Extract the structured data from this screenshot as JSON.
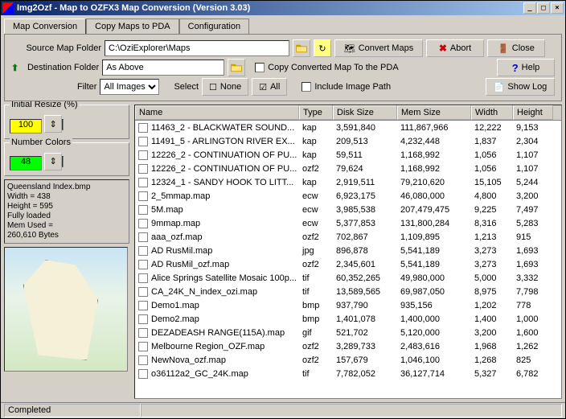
{
  "window": {
    "title": "Img2Ozf - Map to OZFX3 Map Conversion (Version 3.03)"
  },
  "tabs": {
    "map_conversion": "Map Conversion",
    "copy_maps": "Copy Maps to PDA",
    "configuration": "Configuration"
  },
  "toolbar": {
    "source_label": "Source Map Folder",
    "source_value": "C:\\OziExplorer\\Maps",
    "dest_label": "Destination Folder",
    "dest_value": "As Above",
    "filter_label": "Filter",
    "filter_value": "All Images",
    "select_label": "Select",
    "none_btn": "None",
    "all_btn": "All",
    "convert_btn": "Convert Maps",
    "abort_btn": "Abort",
    "close_btn": "Close",
    "copy_pda_checkbox": "Copy Converted Map To the PDA",
    "include_path_checkbox": "Include Image Path",
    "help_btn": "Help",
    "showlog_btn": "Show Log"
  },
  "left": {
    "resize_legend": "Initial Resize (%)",
    "resize_value": "100",
    "colors_legend": "Number Colors",
    "colors_value": "48",
    "info": {
      "l1": "Queensland Index.bmp",
      "l2": "Width = 438",
      "l3": "Height = 595",
      "l4": "Fully loaded",
      "l5": "Mem Used =",
      "l6": "260,610 Bytes"
    }
  },
  "list": {
    "headers": {
      "name": "Name",
      "type": "Type",
      "disk": "Disk Size",
      "mem": "Mem Size",
      "width": "Width",
      "height": "Height"
    },
    "rows": [
      {
        "name": "11463_2 - BLACKWATER SOUND...",
        "type": "kap",
        "disk": "3,591,840",
        "mem": "111,867,966",
        "width": "12,222",
        "height": "9,153"
      },
      {
        "name": "11491_5 - ARLINGTON RIVER EX...",
        "type": "kap",
        "disk": "209,513",
        "mem": "4,232,448",
        "width": "1,837",
        "height": "2,304"
      },
      {
        "name": "12226_2 - CONTINUATION OF PU...",
        "type": "kap",
        "disk": "59,511",
        "mem": "1,168,992",
        "width": "1,056",
        "height": "1,107"
      },
      {
        "name": "12226_2 - CONTINUATION OF PU...",
        "type": "ozf2",
        "disk": "79,624",
        "mem": "1,168,992",
        "width": "1,056",
        "height": "1,107"
      },
      {
        "name": "12324_1 - SANDY HOOK TO LITT...",
        "type": "kap",
        "disk": "2,919,511",
        "mem": "79,210,620",
        "width": "15,105",
        "height": "5,244"
      },
      {
        "name": "2_5mmap.map",
        "type": "ecw",
        "disk": "6,923,175",
        "mem": "46,080,000",
        "width": "4,800",
        "height": "3,200"
      },
      {
        "name": "5M.map",
        "type": "ecw",
        "disk": "3,985,538",
        "mem": "207,479,475",
        "width": "9,225",
        "height": "7,497"
      },
      {
        "name": "9mmap.map",
        "type": "ecw",
        "disk": "5,377,853",
        "mem": "131,800,284",
        "width": "8,316",
        "height": "5,283"
      },
      {
        "name": "aaa_ozf.map",
        "type": "ozf2",
        "disk": "702,867",
        "mem": "1,109,895",
        "width": "1,213",
        "height": "915"
      },
      {
        "name": "AD RusMil.map",
        "type": "jpg",
        "disk": "896,878",
        "mem": "5,541,189",
        "width": "3,273",
        "height": "1,693"
      },
      {
        "name": "AD RusMil_ozf.map",
        "type": "ozf2",
        "disk": "2,345,601",
        "mem": "5,541,189",
        "width": "3,273",
        "height": "1,693"
      },
      {
        "name": "Alice Springs Satellite Mosaic 100p...",
        "type": "tif",
        "disk": "60,352,265",
        "mem": "49,980,000",
        "width": "5,000",
        "height": "3,332"
      },
      {
        "name": "CA_24K_N_index_ozi.map",
        "type": "tif",
        "disk": "13,589,565",
        "mem": "69,987,050",
        "width": "8,975",
        "height": "7,798"
      },
      {
        "name": "Demo1.map",
        "type": "bmp",
        "disk": "937,790",
        "mem": "935,156",
        "width": "1,202",
        "height": "778"
      },
      {
        "name": "Demo2.map",
        "type": "bmp",
        "disk": "1,401,078",
        "mem": "1,400,000",
        "width": "1,400",
        "height": "1,000"
      },
      {
        "name": "DEZADEASH RANGE(115A).map",
        "type": "gif",
        "disk": "521,702",
        "mem": "5,120,000",
        "width": "3,200",
        "height": "1,600"
      },
      {
        "name": "Melbourne Region_OZF.map",
        "type": "ozf2",
        "disk": "3,289,733",
        "mem": "2,483,616",
        "width": "1,968",
        "height": "1,262"
      },
      {
        "name": "NewNova_ozf.map",
        "type": "ozf2",
        "disk": "157,679",
        "mem": "1,046,100",
        "width": "1,268",
        "height": "825"
      },
      {
        "name": "o36112a2_GC_24K.map",
        "type": "tif",
        "disk": "7,782,052",
        "mem": "36,127,714",
        "width": "5,327",
        "height": "6,782"
      }
    ]
  },
  "status": {
    "text": "Completed"
  }
}
